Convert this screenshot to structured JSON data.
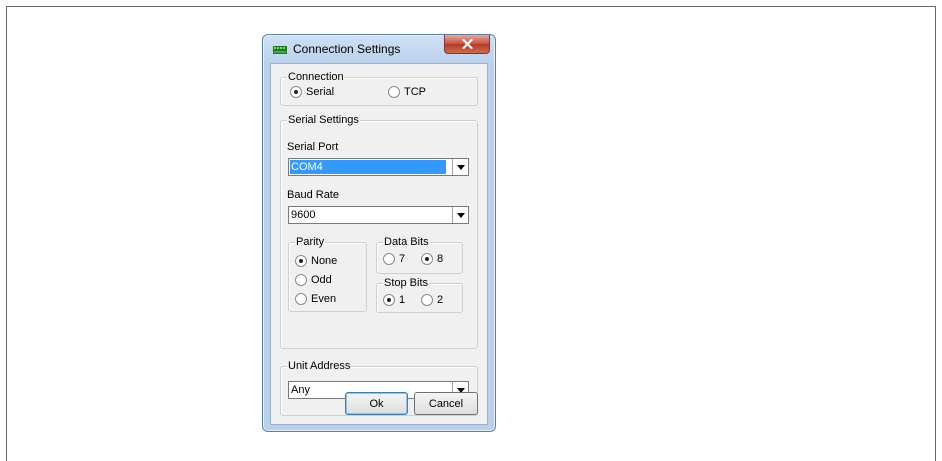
{
  "dialog": {
    "title": "Connection Settings",
    "close_label": "X"
  },
  "connection": {
    "legend": "Connection",
    "options": [
      {
        "label": "Serial",
        "selected": true
      },
      {
        "label": "TCP",
        "selected": false
      }
    ]
  },
  "serial_settings": {
    "legend": "Serial Settings",
    "port_label": "Serial Port",
    "port_value": "COM4",
    "baud_label": "Baud Rate",
    "baud_value": "9600",
    "parity": {
      "legend": "Parity",
      "options": [
        {
          "label": "None",
          "selected": true
        },
        {
          "label": "Odd",
          "selected": false
        },
        {
          "label": "Even",
          "selected": false
        }
      ]
    },
    "data_bits": {
      "legend": "Data Bits",
      "options": [
        {
          "label": "7",
          "selected": false
        },
        {
          "label": "8",
          "selected": true
        }
      ]
    },
    "stop_bits": {
      "legend": "Stop Bits",
      "options": [
        {
          "label": "1",
          "selected": true
        },
        {
          "label": "2",
          "selected": false
        }
      ]
    }
  },
  "unit_address": {
    "legend": "Unit Address",
    "value": "Any"
  },
  "buttons": {
    "ok": "Ok",
    "cancel": "Cancel"
  },
  "colors": {
    "selection": "#3399ff",
    "close_button": "#c7503c"
  }
}
